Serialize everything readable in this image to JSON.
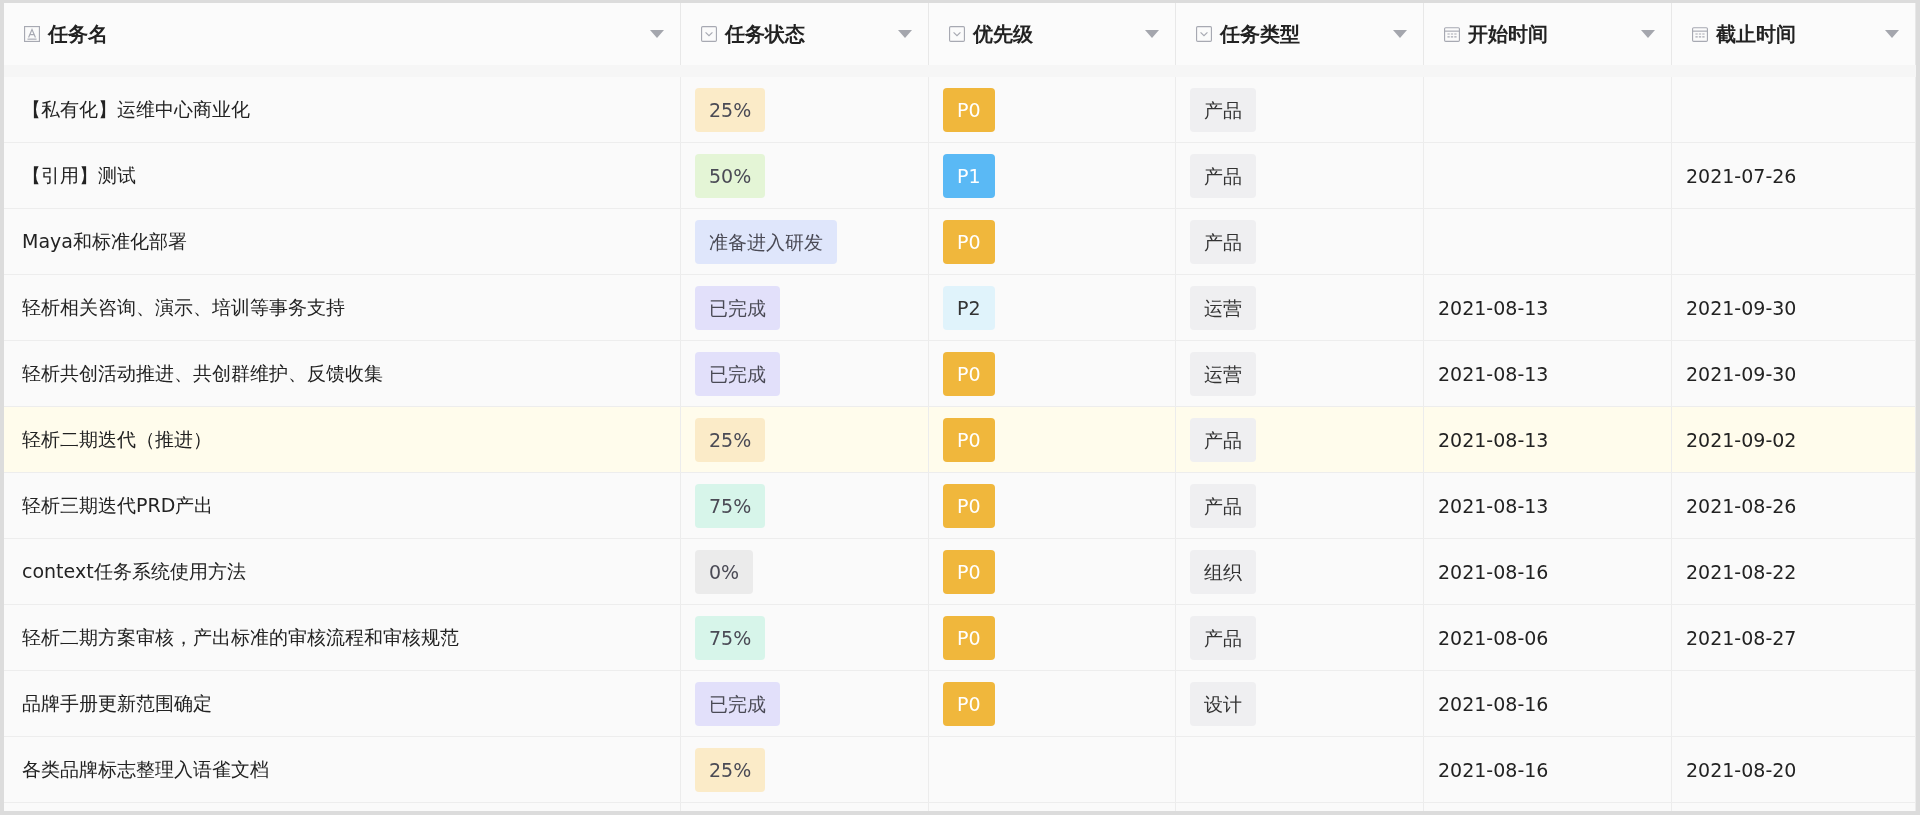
{
  "columns": [
    {
      "label": "任务名",
      "kind": "text"
    },
    {
      "label": "任务状态",
      "kind": "select"
    },
    {
      "label": "优先级",
      "kind": "select"
    },
    {
      "label": "任务类型",
      "kind": "select"
    },
    {
      "label": "开始时间",
      "kind": "date"
    },
    {
      "label": "截止时间",
      "kind": "date"
    }
  ],
  "rows": [
    {
      "name": "【私有化】运维中心商业化",
      "status": {
        "label": "25%",
        "color": "#fbebc8"
      },
      "priority": {
        "label": "P0",
        "color": "#f0b73c"
      },
      "type": "产品",
      "start": "",
      "due": "",
      "highlighted": false
    },
    {
      "name": "【引用】测试",
      "status": {
        "label": "50%",
        "color": "#e4f5d6"
      },
      "priority": {
        "label": "P1",
        "color": "#5ab9f5"
      },
      "type": "产品",
      "start": "",
      "due": "2021-07-26",
      "highlighted": false
    },
    {
      "name": "Maya和标准化部署",
      "status": {
        "label": "准备进入研发",
        "color": "#dfe6fb"
      },
      "priority": {
        "label": "P0",
        "color": "#f0b73c"
      },
      "type": "产品",
      "start": "",
      "due": "",
      "highlighted": false
    },
    {
      "name": "轻析相关咨询、演示、培训等事务支持",
      "status": {
        "label": "已完成",
        "color": "#e2e0fa"
      },
      "priority": {
        "label": "P2",
        "color": "#e0f3fb"
      },
      "type": "运营",
      "start": "2021-08-13",
      "due": "2021-09-30",
      "highlighted": false
    },
    {
      "name": "轻析共创活动推进、共创群维护、反馈收集",
      "status": {
        "label": "已完成",
        "color": "#e2e0fa"
      },
      "priority": {
        "label": "P0",
        "color": "#f0b73c"
      },
      "type": "运营",
      "start": "2021-08-13",
      "due": "2021-09-30",
      "highlighted": false
    },
    {
      "name": "轻析二期迭代（推进）",
      "status": {
        "label": "25%",
        "color": "#fbebc8"
      },
      "priority": {
        "label": "P0",
        "color": "#f0b73c"
      },
      "type": "产品",
      "start": "2021-08-13",
      "due": "2021-09-02",
      "highlighted": true
    },
    {
      "name": "轻析三期迭代PRD产出",
      "status": {
        "label": "75%",
        "color": "#d7f5ea"
      },
      "priority": {
        "label": "P0",
        "color": "#f0b73c"
      },
      "type": "产品",
      "start": "2021-08-13",
      "due": "2021-08-26",
      "highlighted": false
    },
    {
      "name": "context任务系统使用方法",
      "status": {
        "label": "0%",
        "color": "#ebebeb"
      },
      "priority": {
        "label": "P0",
        "color": "#f0b73c"
      },
      "type": "组织",
      "start": "2021-08-16",
      "due": "2021-08-22",
      "highlighted": false
    },
    {
      "name": "轻析二期方案审核，产出标准的审核流程和审核规范",
      "status": {
        "label": "75%",
        "color": "#d7f5ea"
      },
      "priority": {
        "label": "P0",
        "color": "#f0b73c"
      },
      "type": "产品",
      "start": "2021-08-06",
      "due": "2021-08-27",
      "highlighted": false
    },
    {
      "name": "品牌手册更新范围确定",
      "status": {
        "label": "已完成",
        "color": "#e2e0fa"
      },
      "priority": {
        "label": "P0",
        "color": "#f0b73c"
      },
      "type": "设计",
      "start": "2021-08-16",
      "due": "",
      "highlighted": false
    },
    {
      "name": "各类品牌标志整理入语雀文档",
      "status": {
        "label": "25%",
        "color": "#fbebc8"
      },
      "priority": null,
      "type": "",
      "start": "2021-08-16",
      "due": "2021-08-20",
      "highlighted": false
    }
  ]
}
